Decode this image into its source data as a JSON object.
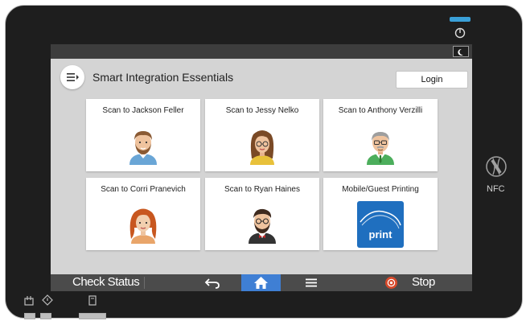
{
  "app": {
    "title": "Smart Integration Essentials",
    "login_label": "Login"
  },
  "tiles": [
    {
      "label": "Scan to Jackson Feller",
      "avatar": "man-beard-avatar"
    },
    {
      "label": "Scan to Jessy Nelko",
      "avatar": "woman-glasses-avatar"
    },
    {
      "label": "Scan to Anthony Verzilli",
      "avatar": "older-man-glasses-avatar"
    },
    {
      "label": "Scan to Corri Pranevich",
      "avatar": "woman-red-hair-avatar"
    },
    {
      "label": "Scan to Ryan Haines",
      "avatar": "man-bowtie-avatar"
    },
    {
      "label": "Mobile/Guest Printing",
      "app_icon_text": "print"
    }
  ],
  "bottom_bar": {
    "check_status_label": "Check Status",
    "stop_label": "Stop"
  },
  "device": {
    "nfc_label": "NFC"
  },
  "colors": {
    "home_accent": "#3f7fd4",
    "stop_red": "#d84a2b",
    "print_app_blue": "#1f6fbf",
    "status_led": "#3aa0d8"
  }
}
